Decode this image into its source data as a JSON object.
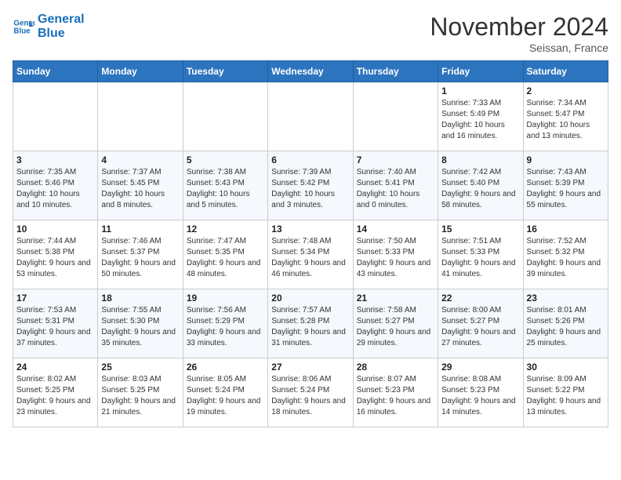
{
  "header": {
    "logo_line1": "General",
    "logo_line2": "Blue",
    "month_title": "November 2024",
    "location": "Seissan, France"
  },
  "days_of_week": [
    "Sunday",
    "Monday",
    "Tuesday",
    "Wednesday",
    "Thursday",
    "Friday",
    "Saturday"
  ],
  "weeks": [
    [
      {
        "day": "",
        "info": ""
      },
      {
        "day": "",
        "info": ""
      },
      {
        "day": "",
        "info": ""
      },
      {
        "day": "",
        "info": ""
      },
      {
        "day": "",
        "info": ""
      },
      {
        "day": "1",
        "info": "Sunrise: 7:33 AM\nSunset: 5:49 PM\nDaylight: 10 hours and 16 minutes."
      },
      {
        "day": "2",
        "info": "Sunrise: 7:34 AM\nSunset: 5:47 PM\nDaylight: 10 hours and 13 minutes."
      }
    ],
    [
      {
        "day": "3",
        "info": "Sunrise: 7:35 AM\nSunset: 5:46 PM\nDaylight: 10 hours and 10 minutes."
      },
      {
        "day": "4",
        "info": "Sunrise: 7:37 AM\nSunset: 5:45 PM\nDaylight: 10 hours and 8 minutes."
      },
      {
        "day": "5",
        "info": "Sunrise: 7:38 AM\nSunset: 5:43 PM\nDaylight: 10 hours and 5 minutes."
      },
      {
        "day": "6",
        "info": "Sunrise: 7:39 AM\nSunset: 5:42 PM\nDaylight: 10 hours and 3 minutes."
      },
      {
        "day": "7",
        "info": "Sunrise: 7:40 AM\nSunset: 5:41 PM\nDaylight: 10 hours and 0 minutes."
      },
      {
        "day": "8",
        "info": "Sunrise: 7:42 AM\nSunset: 5:40 PM\nDaylight: 9 hours and 58 minutes."
      },
      {
        "day": "9",
        "info": "Sunrise: 7:43 AM\nSunset: 5:39 PM\nDaylight: 9 hours and 55 minutes."
      }
    ],
    [
      {
        "day": "10",
        "info": "Sunrise: 7:44 AM\nSunset: 5:38 PM\nDaylight: 9 hours and 53 minutes."
      },
      {
        "day": "11",
        "info": "Sunrise: 7:46 AM\nSunset: 5:37 PM\nDaylight: 9 hours and 50 minutes."
      },
      {
        "day": "12",
        "info": "Sunrise: 7:47 AM\nSunset: 5:35 PM\nDaylight: 9 hours and 48 minutes."
      },
      {
        "day": "13",
        "info": "Sunrise: 7:48 AM\nSunset: 5:34 PM\nDaylight: 9 hours and 46 minutes."
      },
      {
        "day": "14",
        "info": "Sunrise: 7:50 AM\nSunset: 5:33 PM\nDaylight: 9 hours and 43 minutes."
      },
      {
        "day": "15",
        "info": "Sunrise: 7:51 AM\nSunset: 5:33 PM\nDaylight: 9 hours and 41 minutes."
      },
      {
        "day": "16",
        "info": "Sunrise: 7:52 AM\nSunset: 5:32 PM\nDaylight: 9 hours and 39 minutes."
      }
    ],
    [
      {
        "day": "17",
        "info": "Sunrise: 7:53 AM\nSunset: 5:31 PM\nDaylight: 9 hours and 37 minutes."
      },
      {
        "day": "18",
        "info": "Sunrise: 7:55 AM\nSunset: 5:30 PM\nDaylight: 9 hours and 35 minutes."
      },
      {
        "day": "19",
        "info": "Sunrise: 7:56 AM\nSunset: 5:29 PM\nDaylight: 9 hours and 33 minutes."
      },
      {
        "day": "20",
        "info": "Sunrise: 7:57 AM\nSunset: 5:28 PM\nDaylight: 9 hours and 31 minutes."
      },
      {
        "day": "21",
        "info": "Sunrise: 7:58 AM\nSunset: 5:27 PM\nDaylight: 9 hours and 29 minutes."
      },
      {
        "day": "22",
        "info": "Sunrise: 8:00 AM\nSunset: 5:27 PM\nDaylight: 9 hours and 27 minutes."
      },
      {
        "day": "23",
        "info": "Sunrise: 8:01 AM\nSunset: 5:26 PM\nDaylight: 9 hours and 25 minutes."
      }
    ],
    [
      {
        "day": "24",
        "info": "Sunrise: 8:02 AM\nSunset: 5:25 PM\nDaylight: 9 hours and 23 minutes."
      },
      {
        "day": "25",
        "info": "Sunrise: 8:03 AM\nSunset: 5:25 PM\nDaylight: 9 hours and 21 minutes."
      },
      {
        "day": "26",
        "info": "Sunrise: 8:05 AM\nSunset: 5:24 PM\nDaylight: 9 hours and 19 minutes."
      },
      {
        "day": "27",
        "info": "Sunrise: 8:06 AM\nSunset: 5:24 PM\nDaylight: 9 hours and 18 minutes."
      },
      {
        "day": "28",
        "info": "Sunrise: 8:07 AM\nSunset: 5:23 PM\nDaylight: 9 hours and 16 minutes."
      },
      {
        "day": "29",
        "info": "Sunrise: 8:08 AM\nSunset: 5:23 PM\nDaylight: 9 hours and 14 minutes."
      },
      {
        "day": "30",
        "info": "Sunrise: 8:09 AM\nSunset: 5:22 PM\nDaylight: 9 hours and 13 minutes."
      }
    ]
  ]
}
